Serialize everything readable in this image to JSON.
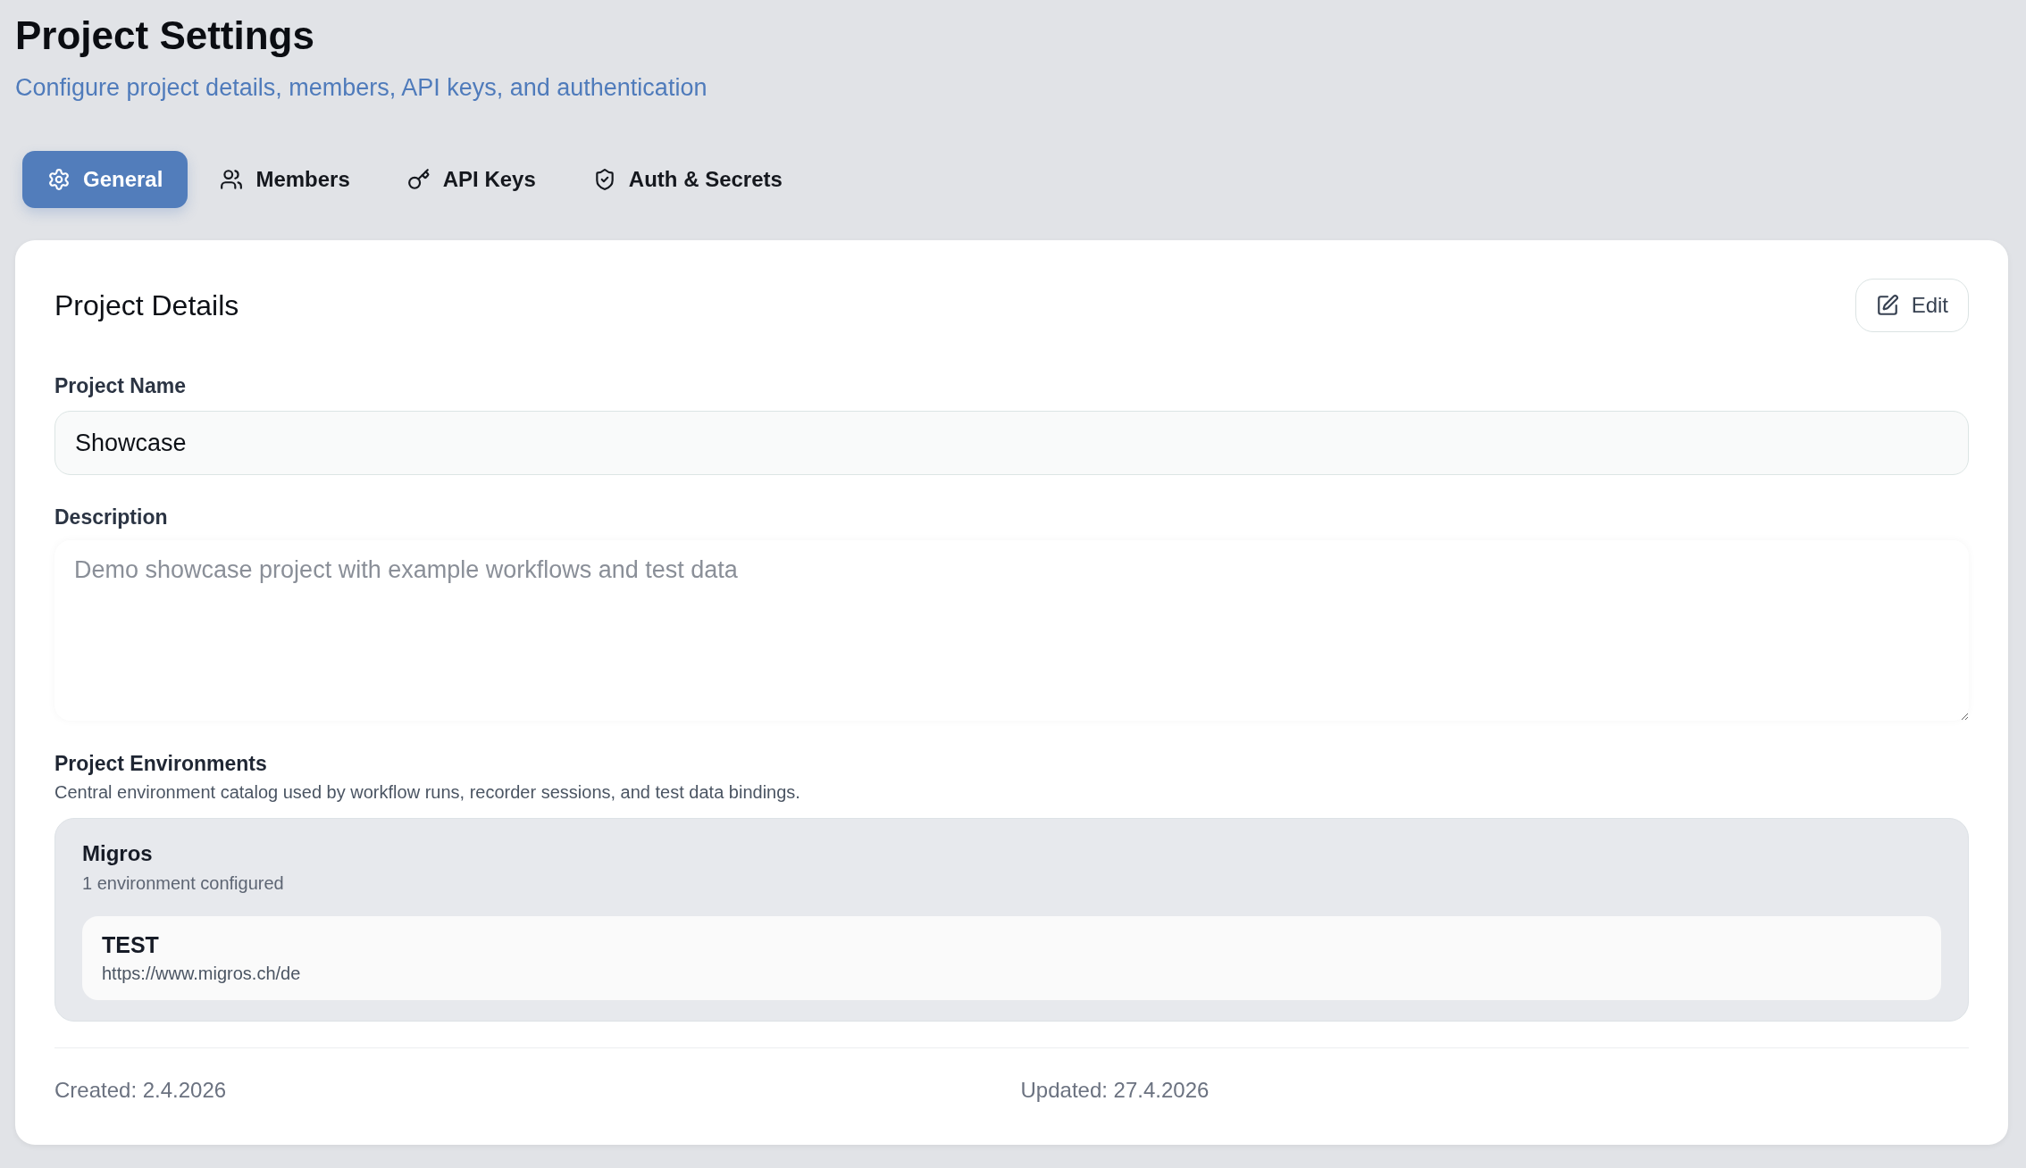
{
  "header": {
    "title": "Project Settings",
    "subtitle": "Configure project details, members, API keys, and authentication"
  },
  "tabs": [
    {
      "label": "General",
      "selected": true
    },
    {
      "label": "Members",
      "selected": false
    },
    {
      "label": "API Keys",
      "selected": false
    },
    {
      "label": "Auth & Secrets",
      "selected": false
    }
  ],
  "details": {
    "title": "Project Details",
    "edit_button": "Edit",
    "name_field": {
      "label": "Project Name",
      "value": "Showcase"
    },
    "description_field": {
      "label": "Description",
      "placeholder": "Demo showcase project with example workflows and test data"
    }
  },
  "environments": {
    "title": "Project Environments",
    "description": "Central environment catalog used by workflow runs, recorder sessions, and test data bindings.",
    "groups": [
      {
        "name": "Migros",
        "count": "1 environment configured",
        "items": [
          {
            "name": "TEST",
            "url": "https://www.migros.ch/de"
          }
        ]
      }
    ]
  },
  "footer": {
    "created": "Created: 2.4.2026",
    "updated": "Updated: 27.4.2026"
  }
}
